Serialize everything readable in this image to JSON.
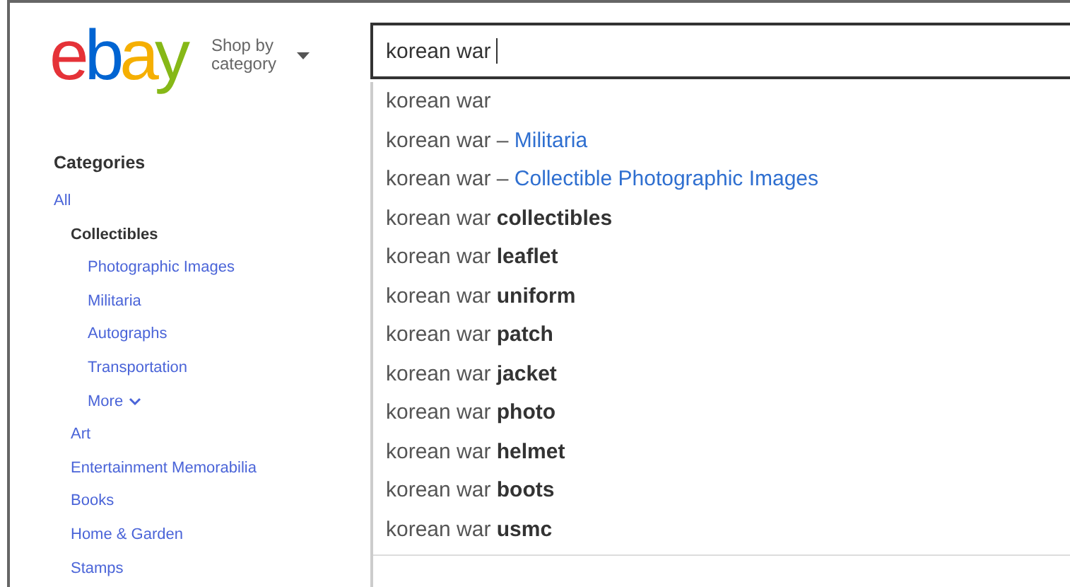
{
  "header": {
    "logo": "ebay",
    "shop_by": "Shop by category"
  },
  "search": {
    "value": "korean war "
  },
  "suggestions": [
    {
      "kind": "query",
      "text": "korean war"
    },
    {
      "kind": "category",
      "text": "korean war –",
      "category": "Militaria"
    },
    {
      "kind": "category",
      "text": "korean war –",
      "category": "Collectible Photographic Images"
    },
    {
      "kind": "query",
      "text": "korean war **collectibles**"
    },
    {
      "kind": "query",
      "text": "korean war **leaflet**"
    },
    {
      "kind": "query",
      "text": "korean war **uniform**"
    },
    {
      "kind": "query",
      "text": "korean war **patch**"
    },
    {
      "kind": "query",
      "text": "korean war **jacket**"
    },
    {
      "kind": "query",
      "text": "korean war **photo**"
    },
    {
      "kind": "query",
      "text": "korean war **helmet**"
    },
    {
      "kind": "query",
      "text": "korean war **boots**"
    },
    {
      "kind": "query",
      "text": "korean war **usmc**"
    }
  ],
  "sidebar": {
    "title": "Categories",
    "items": [
      {
        "label": "All",
        "selected": false,
        "children": [
          {
            "label": "Collectibles",
            "selected": true,
            "more": "More",
            "children": [
              {
                "label": "Photographic Images",
                "selected": false
              },
              {
                "label": "Militaria",
                "selected": false
              },
              {
                "label": "Autographs",
                "selected": false
              },
              {
                "label": "Transportation",
                "selected": false
              }
            ]
          },
          {
            "label": "Art",
            "selected": false
          },
          {
            "label": "Entertainment Memorabilia",
            "selected": false
          },
          {
            "label": "Books",
            "selected": false
          },
          {
            "label": "Home & Garden",
            "selected": false
          },
          {
            "label": "Stamps",
            "selected": false
          }
        ]
      }
    ]
  }
}
